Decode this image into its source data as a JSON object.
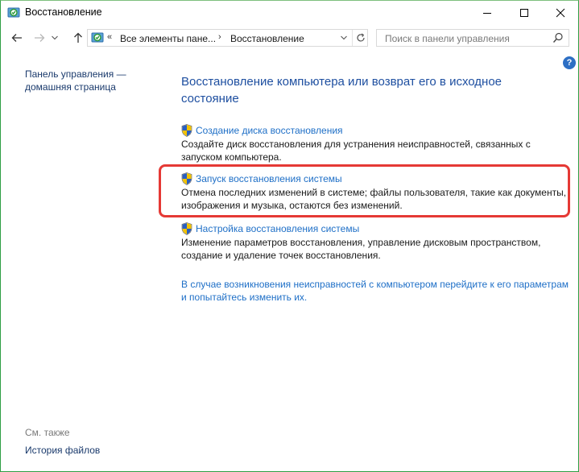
{
  "window": {
    "title": "Восстановление",
    "controls": {
      "minimize": "minimize",
      "maximize": "maximize",
      "close": "close"
    }
  },
  "address_bar": {
    "overflow": "«",
    "segments": [
      "Все элементы пане...",
      "Восстановление"
    ],
    "separator": "›"
  },
  "search": {
    "placeholder": "Поиск в панели управления"
  },
  "sidebar": {
    "home_link": "Панель управления — домашняя страница",
    "see_also_title": "См. также",
    "see_also_link": "История файлов"
  },
  "main": {
    "title": "Восстановление компьютера или возврат его в исходное состояние",
    "tasks": [
      {
        "link": "Создание диска восстановления",
        "description": "Создайте диск восстановления для устранения неисправностей, связанных с запуском компьютера."
      },
      {
        "link": "Запуск восстановления системы",
        "description": "Отмена последних изменений в системе; файлы пользователя, такие как документы, изображения и музыка, остаются без изменений."
      },
      {
        "link": "Настройка восстановления системы",
        "description": "Изменение параметров восстановления, управление дисковым пространством, создание и удаление точек восстановления."
      }
    ],
    "bottom_link": "В случае возникновения неисправностей с компьютером перейдите к его параметрам и попытайтесь изменить их."
  },
  "colors": {
    "link": "#1e6fc7",
    "title": "#1e4fa0",
    "highlight": "#e53935",
    "help": "#2d6fc4"
  }
}
